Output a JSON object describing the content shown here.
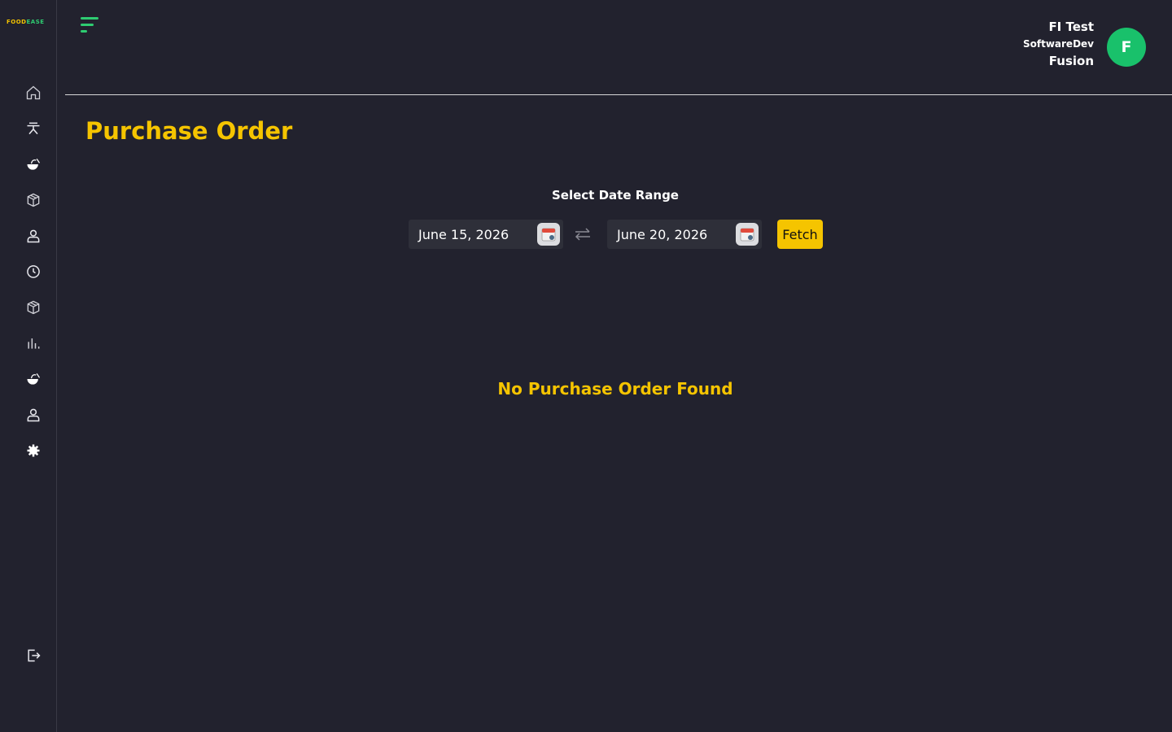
{
  "app": {
    "logo_part1": "FOOD",
    "logo_part2": "EASE"
  },
  "sidebar": {
    "items": [
      {
        "icon": "home-icon"
      },
      {
        "icon": "dining-table-icon"
      },
      {
        "icon": "food-icon"
      },
      {
        "icon": "box-icon"
      },
      {
        "icon": "user-icon"
      },
      {
        "icon": "clock-icon"
      },
      {
        "icon": "package-icon"
      },
      {
        "icon": "bar-chart-icon"
      },
      {
        "icon": "food-bowl-icon"
      },
      {
        "icon": "user-profile-icon"
      },
      {
        "icon": "settings-gear-icon"
      }
    ],
    "logout_icon": "logout-icon"
  },
  "header": {
    "user_name": "FI Test",
    "user_org": "SoftwareDev",
    "user_location": "Fusion",
    "avatar_letter": "F"
  },
  "main": {
    "title": "Purchase Order",
    "date_range_label": "Select Date Range",
    "start_date": "June 15, 2026",
    "end_date": "June 20, 2026",
    "fetch_label": "Fetch",
    "empty_message": "No Purchase Order Found"
  },
  "colors": {
    "background": "#22222e",
    "accent": "#f5c400",
    "avatar": "#19c16b",
    "menu_icon": "#2ecc71"
  }
}
